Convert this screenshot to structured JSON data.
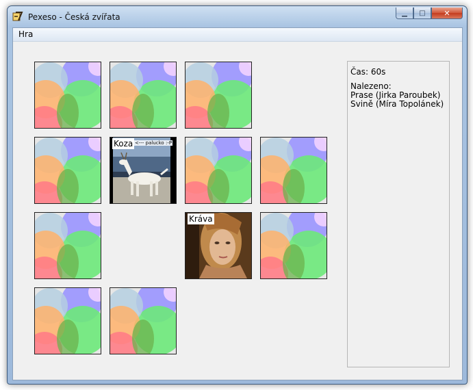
{
  "window": {
    "title": "Pexeso - Česká zvířata",
    "controls": {
      "minimize": "minimize",
      "maximize": "maximize",
      "close": "close"
    }
  },
  "menu": {
    "game_label": "Hra"
  },
  "board": {
    "rows": 4,
    "cols": 4,
    "card_back_colors": [
      "#9a95ff",
      "#6de97a",
      "#ffb26b",
      "#ff7d86",
      "#b5cfe1"
    ],
    "cards": [
      {
        "state": "hidden"
      },
      {
        "state": "hidden"
      },
      {
        "state": "hidden"
      },
      {
        "state": "removed"
      },
      {
        "state": "hidden"
      },
      {
        "state": "revealed",
        "label": "Koza",
        "caption": "<--- palucko :-P",
        "image": "goat-photo"
      },
      {
        "state": "hidden"
      },
      {
        "state": "hidden"
      },
      {
        "state": "hidden"
      },
      {
        "state": "removed"
      },
      {
        "state": "revealed",
        "label": "Kráva",
        "image": "woman-portrait-photo"
      },
      {
        "state": "hidden"
      },
      {
        "state": "hidden"
      },
      {
        "state": "hidden"
      },
      {
        "state": "removed"
      },
      {
        "state": "removed"
      }
    ]
  },
  "status": {
    "time": "Čas: 60s",
    "found_heading": "Nalezeno:",
    "found": [
      "Prase (Jirka Paroubek)",
      "Svině (Míra Topolánek)"
    ]
  }
}
